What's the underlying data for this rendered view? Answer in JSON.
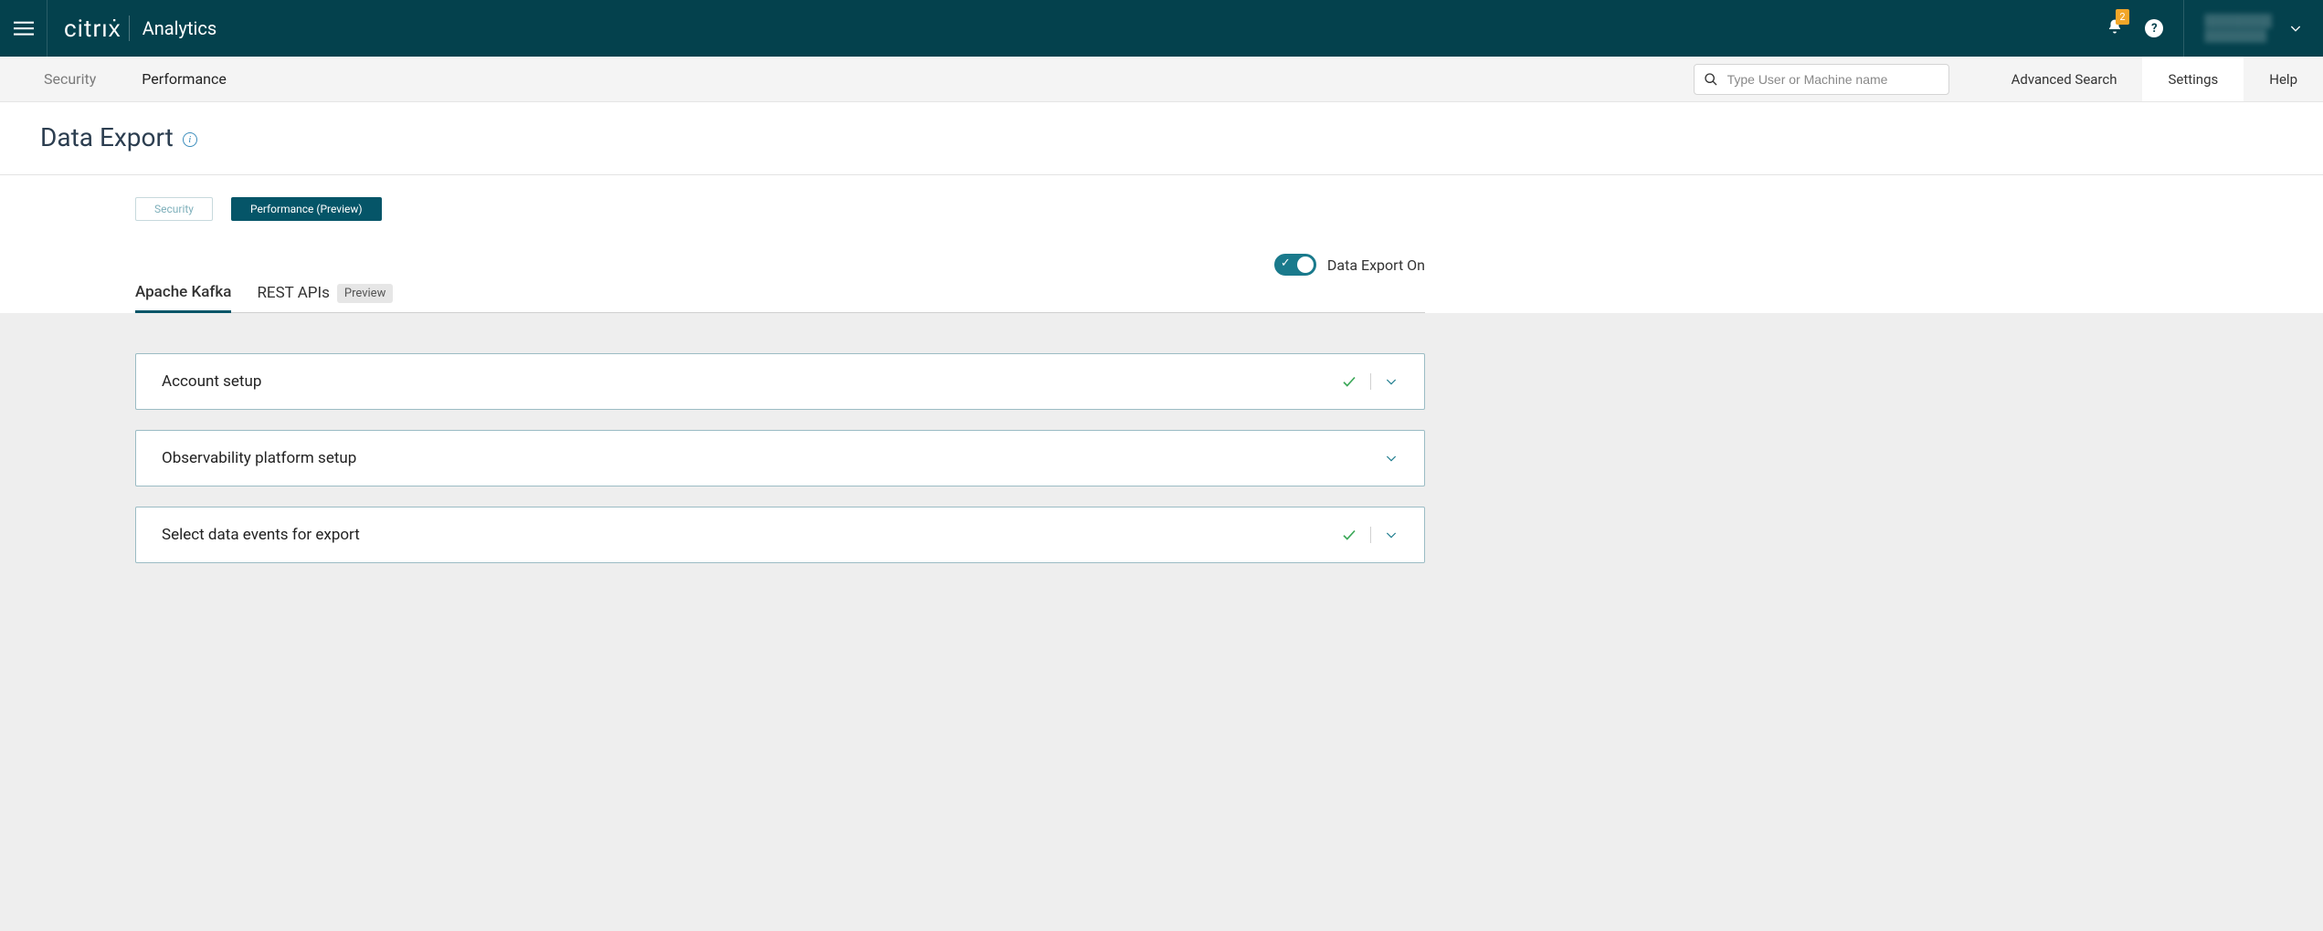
{
  "header": {
    "brand": "citrıẋ",
    "product": "Analytics",
    "notification_count": "2",
    "user_line1": "████████",
    "user_line2": "████████"
  },
  "subnav": {
    "tabs": [
      "Security",
      "Performance"
    ],
    "search_placeholder": "Type User or Machine name",
    "links": [
      "Advanced Search",
      "Settings",
      "Help"
    ]
  },
  "page": {
    "title": "Data Export"
  },
  "pills": {
    "security": "Security",
    "performance": "Performance (Preview)"
  },
  "toggle": {
    "label": "Data Export On",
    "state": "on"
  },
  "sub_tabs": {
    "kafka": "Apache Kafka",
    "rest": "REST APIs",
    "preview_badge": "Preview"
  },
  "panels": [
    {
      "title": "Account setup",
      "done": true
    },
    {
      "title": "Observability platform setup",
      "done": false
    },
    {
      "title": "Select data events for export",
      "done": true
    }
  ]
}
